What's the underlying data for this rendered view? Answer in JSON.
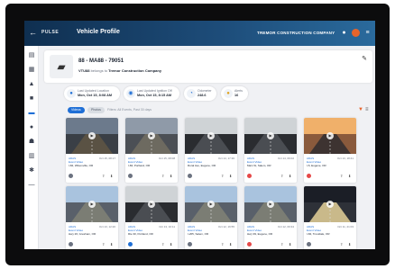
{
  "header": {
    "back": "←",
    "logo": "PULSE",
    "title": "Vehicle Profile",
    "company": "TREMOR CONSTRUCTION COMPANY"
  },
  "vehicle": {
    "name": "88 - MA88 - 79051",
    "sub_label": "VTU88",
    "sub_mid": "belongs to",
    "company": "Tremor Construction Company"
  },
  "stats": [
    {
      "icon": "location-icon",
      "label": "Last Updated Location",
      "value": "Mon, Oct 15, 8:08 AM"
    },
    {
      "icon": "power-icon",
      "label": "Last Updated Ignition Off",
      "value": "Mon, Oct 15, 8:15 AM"
    },
    {
      "icon": "gauge-icon",
      "label": "Odometer",
      "value": "248.6"
    },
    {
      "icon": "alert-icon",
      "label": "Alerts",
      "value": "16"
    }
  ],
  "filters": {
    "pill_1": "Videos",
    "pill_2": "Photos",
    "text": "Filters: All Events, Past 30 days"
  },
  "cards": [
    {
      "tag": "ADAS",
      "time": "Oct 15, 08:17",
      "type": "Event Video",
      "loc": "I-84, Wilsonville, OR",
      "badge_color": "#6b7280",
      "scene": "dusk"
    },
    {
      "tag": "ADAS",
      "time": "Oct 15, 08:08",
      "type": "Event Video",
      "loc": "I-84, Portland, OR",
      "badge_color": "#6b7280",
      "scene": "road"
    },
    {
      "tag": "ADAS",
      "time": "Oct 14, 17:36",
      "type": "Event Video",
      "loc": "Rural Ave, Eugene, OR",
      "badge_color": "#6b7280",
      "scene": "cabin"
    },
    {
      "tag": "ADAS",
      "time": "Oct 14, 09:02",
      "type": "Event Video",
      "loc": "Main St, Salem, OR",
      "badge_color": "#e54848",
      "scene": "cabin"
    },
    {
      "tag": "ADAS",
      "time": "Oct 13, 18:41",
      "type": "Event Video",
      "loc": "I-5, Eugene, OR",
      "badge_color": "#e54848",
      "scene": "sunset"
    },
    {
      "tag": "ADAS",
      "time": "Oct 13, 12:20",
      "type": "Event Video",
      "loc": "Hwy 26, Gresham, OR",
      "badge_color": "#6b7280",
      "scene": "day"
    },
    {
      "tag": "ADAS",
      "time": "Oct 13, 10:11",
      "type": "Event Video",
      "loc": "Rte 30, Portland, OR",
      "badge_color": "#1f6fd6",
      "scene": "cabin"
    },
    {
      "tag": "ADAS",
      "time": "Oct 12, 16:55",
      "type": "Event Video",
      "loc": "I-205, Salem, OR",
      "badge_color": "#6b7280",
      "scene": "day"
    },
    {
      "tag": "ADAS",
      "time": "Oct 12, 09:34",
      "type": "Event Video",
      "loc": "Hwy 99, Eugene, OR",
      "badge_color": "#e54848",
      "scene": "day"
    },
    {
      "tag": "ADAS",
      "time": "Oct 11, 21:03",
      "type": "Event Video",
      "loc": "I-84, Troutdale, OR",
      "badge_color": "#6b7280",
      "scene": "night"
    }
  ],
  "sidebar_icons": [
    "dashboard-icon",
    "grid-icon",
    "alert-icon",
    "truck-icon",
    "camera-icon",
    "location-icon",
    "users-icon",
    "reports-icon",
    "settings-icon",
    "more-icon"
  ]
}
